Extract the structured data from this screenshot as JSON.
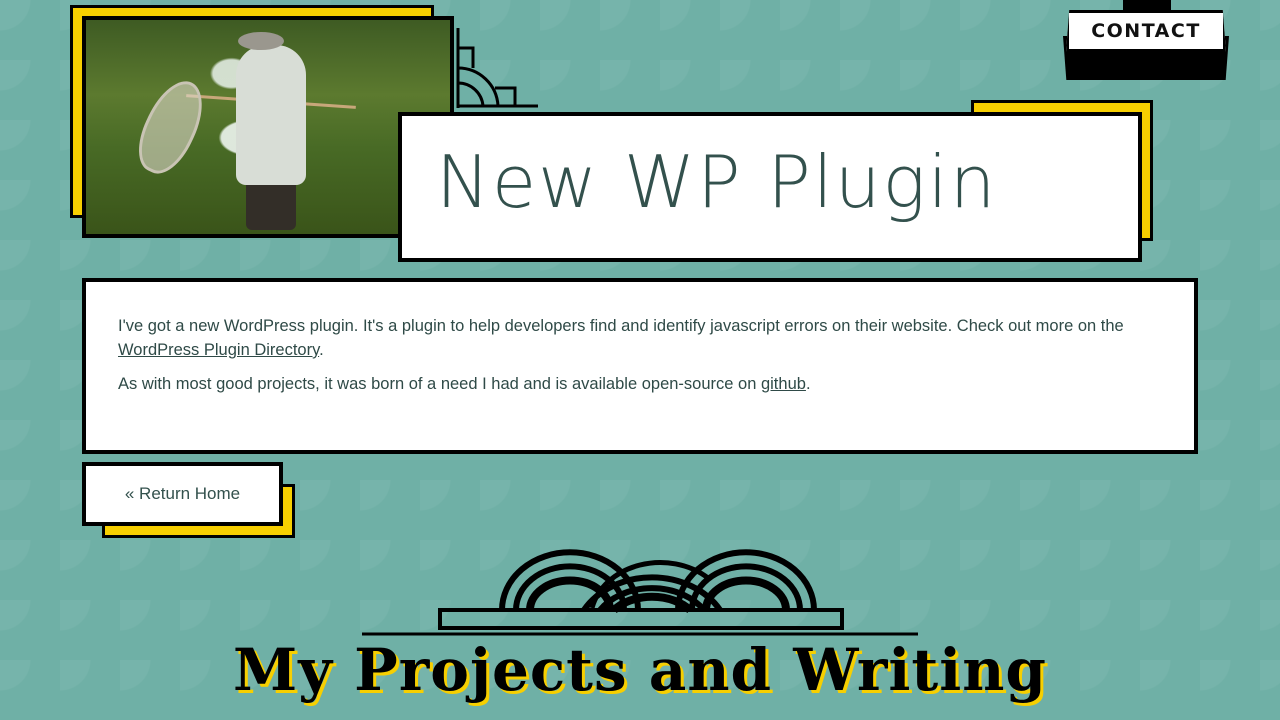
{
  "header": {
    "contact_label": "CONTACT"
  },
  "post": {
    "title": "New WP Plugin",
    "para1_text": "I've got a new WordPress plugin. It's a plugin to help developers find and identify javascript errors on their website. Check out more on the ",
    "para1_link": "WordPress Plugin Directory",
    "para1_end": ".",
    "para2_text": "As with most good projects, it was born of a need I had and is available open-source on ",
    "para2_link": "github",
    "para2_end": "."
  },
  "nav": {
    "return_label": "« Return Home"
  },
  "footer": {
    "title": "My Projects and Writing"
  },
  "colors": {
    "background": "#6fb0a6",
    "accent": "#f7cf00",
    "text": "#2f4a47"
  }
}
